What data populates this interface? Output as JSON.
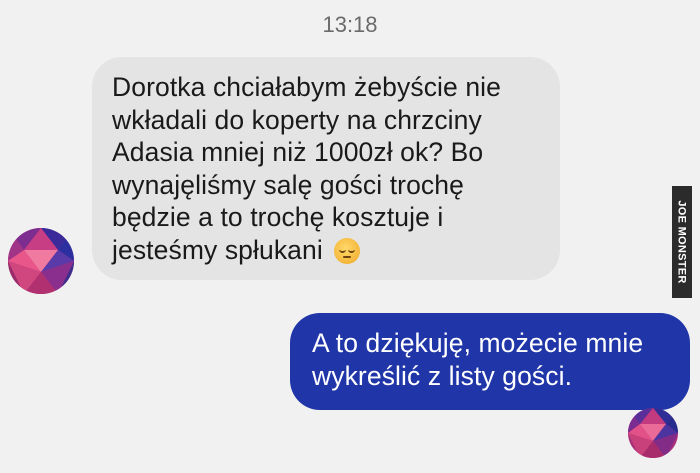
{
  "header": {
    "timestamp": "13:18"
  },
  "messages": {
    "incoming": {
      "text": "Dorotka chciałabym żebyście nie wkładali do koperty na chrzciny Adasia mniej niż 1000zł ok? Bo wynajęliśmy salę gości trochę będzie a to trochę kosztuje i jesteśmy spłukani",
      "emoji": "pensive-face-icon"
    },
    "outgoing": {
      "text": "A to dziękuję, możecie mnie wykreślić z listy gości."
    }
  },
  "watermark": {
    "text": "JOE MONSTER"
  },
  "colors": {
    "background": "#f1f1f1",
    "incoming_bubble": "#e4e4e4",
    "outgoing_bubble": "#1f35a8",
    "outgoing_text": "#ffffff"
  }
}
